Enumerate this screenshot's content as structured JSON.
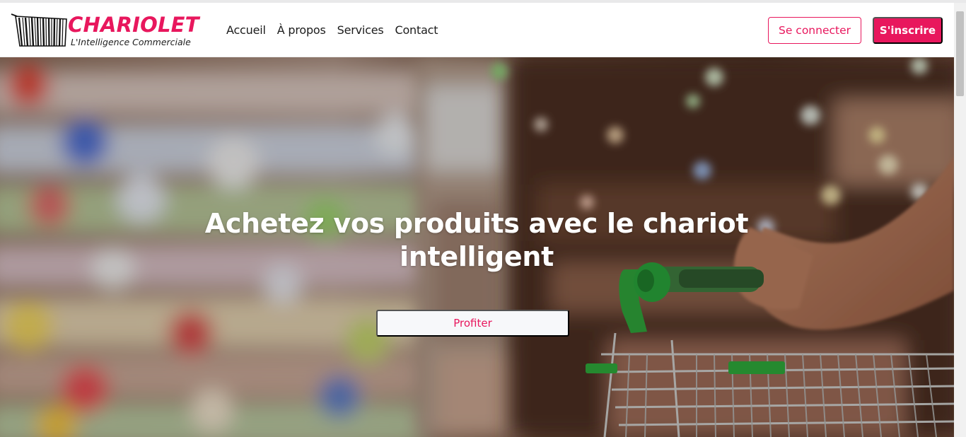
{
  "brand": {
    "name": "CHARIOLET",
    "tagline": "L'Intelligence Commerciale",
    "logo_icon": "barcode-cart-icon",
    "accent_color": "#e8175d"
  },
  "nav": {
    "items": [
      {
        "label": "Accueil"
      },
      {
        "label": "À propos"
      },
      {
        "label": "Services"
      },
      {
        "label": "Contact"
      }
    ]
  },
  "auth": {
    "login_label": "Se connecter",
    "signup_label": "S'inscrire"
  },
  "hero": {
    "title": "Achetez vos produits avec le chariot intelligent",
    "cta_label": "Profiter",
    "background": "blurred-supermarket-aisle-with-shopping-cart"
  }
}
